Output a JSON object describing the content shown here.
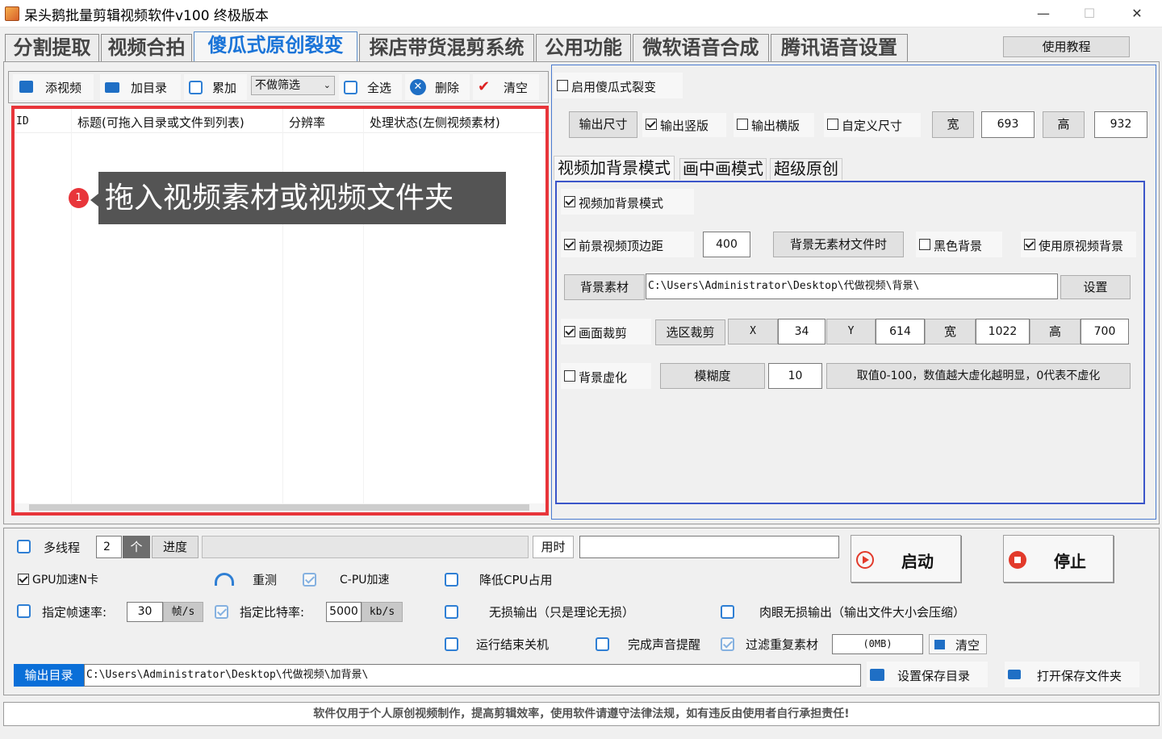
{
  "window": {
    "title": "呆头鹅批量剪辑视频软件v100 终极版本",
    "minimize": "—",
    "maximize": "☐",
    "close": "✕"
  },
  "tabs": [
    "分割提取",
    "视频合拍",
    "傻瓜式原创裂变",
    "探店带货混剪系统",
    "公用功能",
    "微软语音合成",
    "腾讯语音设置"
  ],
  "help_button": "使用教程",
  "toolbar": {
    "add_video": "添视频",
    "add_dir": "加目录",
    "accumulate": "累加",
    "filter_select": "不做筛选",
    "select_all": "全选",
    "delete": "删除",
    "clear": "清空"
  },
  "table": {
    "headers": [
      "ID",
      "标题(可拖入目录或文件到列表)",
      "分辨率",
      "处理状态(左侧视频素材)"
    ],
    "tooltip_badge": "1",
    "tooltip": "拖入视频素材或视频文件夹"
  },
  "right": {
    "enable_label": "启用傻瓜式裂变",
    "output_size_btn": "输出尺寸",
    "output_vertical": "输出竖版",
    "output_horizontal": "输出横版",
    "custom_size": "自定义尺寸",
    "width_label": "宽",
    "width_value": "693",
    "height_label": "高",
    "height_value": "932",
    "subtabs": [
      "视频加背景模式",
      "画中画模式",
      "超级原创"
    ],
    "bg_mode_label": "视频加背景模式",
    "fg_margin_label": "前景视频顶边距",
    "fg_margin_value": "400",
    "bg_no_material_btn": "背景无素材文件时",
    "black_bg": "黑色背景",
    "use_orig_bg": "使用原视频背景",
    "bg_material_btn": "背景素材",
    "bg_path": "C:\\Users\\Administrator\\Desktop\\代做视频\\背景\\",
    "set_btn": "设置",
    "crop_label": "画面裁剪",
    "select_crop_btn": "选区裁剪",
    "x_label": "X",
    "x_value": "34",
    "y_label": "Y",
    "y_value": "614",
    "w_label": "宽",
    "w_value": "1022",
    "h_label": "高",
    "h_value": "700",
    "blur_label": "背景虚化",
    "blur_degree_btn": "模糊度",
    "blur_value": "10",
    "blur_hint": "取值0-100，数值越大虚化越明显，0代表不虚化"
  },
  "bottom": {
    "multithread": "多线程",
    "thread_count": "2",
    "thread_unit": "个",
    "progress_label": "进度",
    "time_label": "用时",
    "time_value": "",
    "start": "启动",
    "stop": "停止",
    "gpu": "GPU加速N卡",
    "retest": "重测",
    "cpu_accel": "C-PU加速",
    "lower_cpu": "降低CPU占用",
    "fps_label": "指定帧速率:",
    "fps_value": "30",
    "fps_unit": "帧/s",
    "bitrate_label": "指定比特率:",
    "bitrate_value": "5000",
    "bitrate_unit": "kb/s",
    "lossless": "无损输出（只是理论无损）",
    "visual_lossless": "肉眼无损输出（输出文件大小会压缩）",
    "shutdown": "运行结束关机",
    "sound_alert": "完成声音提醒",
    "filter_dup": "过滤重复素材",
    "dup_size": "(0MB)",
    "clear": "清空",
    "output_dir_label": "输出目录",
    "output_dir": "C:\\Users\\Administrator\\Desktop\\代做视频\\加背景\\",
    "set_save_dir": "设置保存目录",
    "open_save_dir": "打开保存文件夹"
  },
  "footer": "软件仅用于个人原创视频制作，提高剪辑效率，使用软件请遵守法律法规，如有违反由使用者自行承担责任!"
}
